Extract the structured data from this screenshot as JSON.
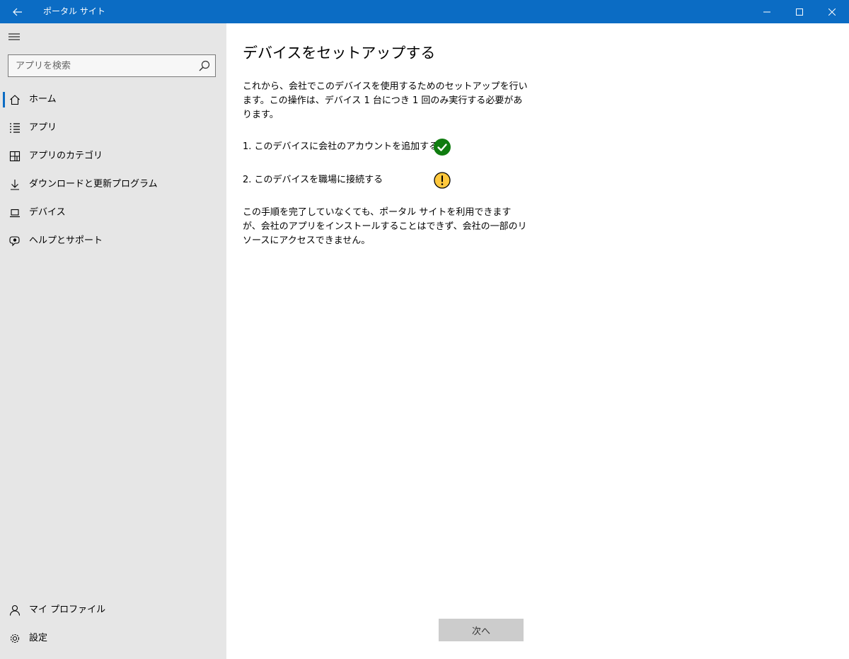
{
  "window": {
    "title": "ポータル サイト",
    "accent_color": "#0b6cc4"
  },
  "sidebar": {
    "search_placeholder": "アプリを検索",
    "items": [
      {
        "label": "ホーム",
        "icon": "home-icon",
        "active": true
      },
      {
        "label": "アプリ",
        "icon": "apps-list-icon"
      },
      {
        "label": "アプリのカテゴリ",
        "icon": "categories-icon"
      },
      {
        "label": "ダウンロードと更新プログラム",
        "icon": "download-icon"
      },
      {
        "label": "デバイス",
        "icon": "laptop-icon"
      },
      {
        "label": "ヘルプとサポート",
        "icon": "help-support-icon"
      }
    ],
    "bottom_items": [
      {
        "label": "マイ プロファイル",
        "icon": "person-icon"
      },
      {
        "label": "設定",
        "icon": "gear-icon"
      }
    ]
  },
  "main": {
    "title": "デバイスをセットアップする",
    "intro": "これから、会社でこのデバイスを使用するためのセットアップを行います。この操作は、デバイス 1 台につき 1 回のみ実行する必要があります。",
    "steps": [
      {
        "label": "1. このデバイスに会社のアカウントを追加する",
        "status": "complete",
        "status_color": "#107c10"
      },
      {
        "label": "2. このデバイスを職場に接続する",
        "status": "warning",
        "status_color": "#ffc83d"
      }
    ],
    "note": "この手順を完了していなくても、ポータル サイトを利用できますが、会社のアプリをインストールすることはできず、会社の一部のリソースにアクセスできません。",
    "next_button": "次へ"
  }
}
